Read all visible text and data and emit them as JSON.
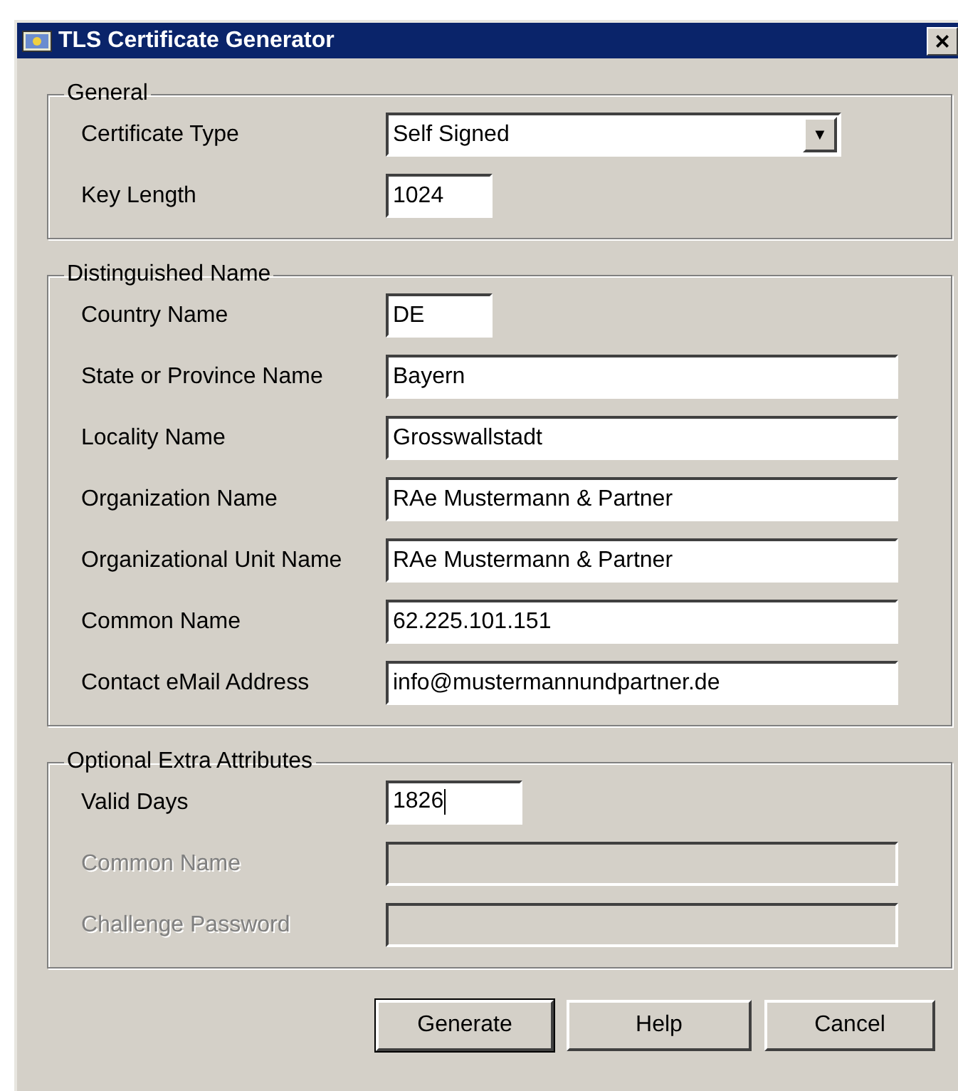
{
  "window": {
    "title": "TLS Certificate Generator",
    "close": "×"
  },
  "groups": [
    {
      "title": "General",
      "fields": [
        {
          "label": "Certificate Type",
          "kind": "combo",
          "value": "Self Signed",
          "disabled": false,
          "arrow": "▼"
        },
        {
          "label": "Key Length",
          "kind": "short",
          "value": "1024",
          "disabled": false
        }
      ]
    },
    {
      "title": "Distinguished Name",
      "fields": [
        {
          "label": "Country Name",
          "kind": "short",
          "value": "DE",
          "disabled": false
        },
        {
          "label": "State or Province Name",
          "kind": "long",
          "value": "Bayern",
          "disabled": false
        },
        {
          "label": "Locality Name",
          "kind": "long",
          "value": "Grosswallstadt",
          "disabled": false
        },
        {
          "label": "Organization Name",
          "kind": "long",
          "value": "RAe Mustermann & Partner",
          "disabled": false
        },
        {
          "label": "Organizational Unit Name",
          "kind": "long",
          "value": "RAe Mustermann & Partner",
          "disabled": false
        },
        {
          "label": "Common Name",
          "kind": "long",
          "value": "62.225.101.151",
          "disabled": false
        },
        {
          "label": "Contact eMail Address",
          "kind": "long",
          "value": "info@mustermannundpartner.de",
          "disabled": false
        }
      ]
    },
    {
      "title": "Optional Extra Attributes",
      "fields": [
        {
          "label": "Valid Days",
          "kind": "medium",
          "value": "1826",
          "disabled": false,
          "focused": true
        },
        {
          "label": "Common Name",
          "kind": "long",
          "disabled": true
        },
        {
          "label": "Challenge Password",
          "kind": "long",
          "disabled": true
        }
      ]
    }
  ],
  "buttons": [
    {
      "label": "Generate",
      "default": true
    },
    {
      "label": "Help",
      "default": false
    },
    {
      "label": "Cancel",
      "default": false
    }
  ]
}
